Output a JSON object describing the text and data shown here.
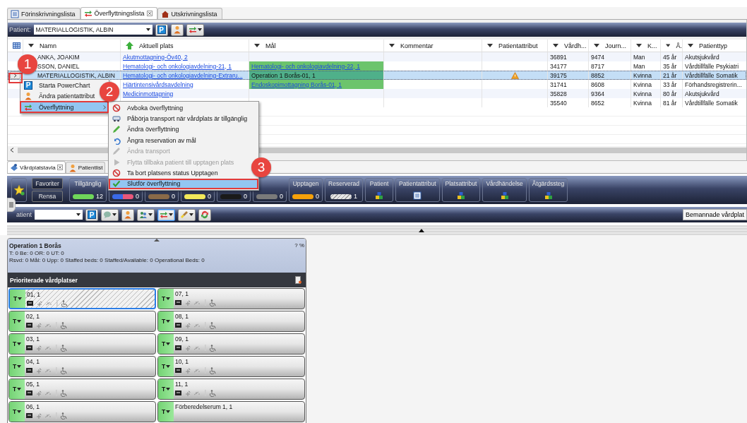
{
  "doc_tabs": [
    {
      "label": "Förinskrivningslista",
      "kind": "list",
      "selected": false,
      "closable": false
    },
    {
      "label": "Överflyttningslista",
      "kind": "transfer",
      "selected": true,
      "closable": true
    },
    {
      "label": "Utskrivningslista",
      "kind": "house",
      "selected": false,
      "closable": false
    }
  ],
  "patient_bar": {
    "label": "Patient:",
    "value": "MATERIALLOGISTIK, ALBIN",
    "buttons": [
      {
        "kind": "letter",
        "letter": "P",
        "dropdown": false,
        "selected": false
      },
      {
        "kind": "person",
        "dropdown": false,
        "selected": false
      },
      {
        "kind": "transfer",
        "dropdown": true,
        "selected": false
      }
    ]
  },
  "table": {
    "columns": [
      {
        "label": "Namn",
        "sorted": false
      },
      {
        "label": "Aktuell plats",
        "sorted": true
      },
      {
        "label": "Mål",
        "sorted": false
      },
      {
        "label": "Kommentar",
        "sorted": false
      },
      {
        "label": "Patientattribut",
        "sorted": false
      },
      {
        "label": "Vårdh...",
        "sorted": false
      },
      {
        "label": "Journ...",
        "sorted": false
      },
      {
        "label": "K...",
        "sorted": false
      },
      {
        "label": "Å.",
        "sorted": false
      },
      {
        "label": "Patienttyp",
        "sorted": false
      }
    ],
    "rows": [
      {
        "name": "ANKA, JOAKIM",
        "current": "Akutmottagning-Öv40, 2",
        "warning": false,
        "visit": "36891",
        "record": "9474",
        "sex": "Man",
        "age": "45 år",
        "type": "Akutsjukvård",
        "selected": false,
        "expanded": false
      },
      {
        "name": "SSON, DANIEL",
        "current": "Hematologi- och onkologiavdelning-21, 1",
        "target": {
          "text": "Hematologi- och onkologiavdelning-22, 1",
          "color": "#6cc46c",
          "linked": true
        },
        "warning": false,
        "visit": "34177",
        "record": "8717",
        "sex": "Man",
        "age": "35 år",
        "type": "Vårdtillfälle Psykiatri",
        "selected": false,
        "expanded": false
      },
      {
        "name": "MATERIALLOGISTIK, ALBIN",
        "current": "Hematologi- och onkologiavdelning-Extraru...",
        "target": {
          "text": "Operation 1 Borås-01, 1",
          "color": "#4fb08a",
          "linked": false
        },
        "warning": true,
        "visit": "39175",
        "record": "8852",
        "sex": "Kvinna",
        "age": "21 år",
        "type": "Vårdtillfälle Somatik",
        "selected": true,
        "expanded": true
      },
      {
        "current": "Hjärtintensivårdsavdelning",
        "target": {
          "text": "Endoskopimottagning Borås-01, 1",
          "color": "#6cc46c",
          "linked": true
        },
        "warning": false,
        "visit": "31741",
        "record": "8608",
        "sex": "Kvinna",
        "age": "33 år",
        "type": "Förhandsregistrerin...",
        "selected": false,
        "expanded": false
      },
      {
        "current": "Medicinmottagning",
        "warning": false,
        "visit": "35828",
        "record": "9364",
        "sex": "Kvinna",
        "age": "80 år",
        "type": "Akutsjukvård",
        "selected": false,
        "expanded": false
      },
      {
        "warning": false,
        "visit": "35540",
        "record": "8652",
        "sex": "Kvinna",
        "age": "81 år",
        "type": "Vårdtillfälle Somatik",
        "selected": false,
        "expanded": false
      }
    ]
  },
  "menu": {
    "items": [
      {
        "label": "Starta PowerChart",
        "kind": "letter",
        "letter": "P",
        "selected": false,
        "submenu": false
      },
      {
        "label": "Ändra patientattribut",
        "kind": "person",
        "selected": false,
        "submenu": false
      },
      {
        "label": "Överflyttning",
        "kind": "transfer",
        "selected": true,
        "submenu": true
      }
    ],
    "submenu": [
      {
        "label": "Avboka överflyttning",
        "kind": "cancel",
        "disabled": false,
        "selected": false
      },
      {
        "label": "Påbörja transport när vårdplats är tillgänglig",
        "kind": "vehicle",
        "disabled": false,
        "selected": false
      },
      {
        "label": "Ändra överflyttning",
        "kind": "pencil",
        "disabled": false,
        "selected": false
      },
      {
        "label": "Ångra reservation av mål",
        "kind": "undo",
        "disabled": false,
        "selected": false
      },
      {
        "label": "Ändra transport",
        "kind": "pencil",
        "disabled": true,
        "selected": false
      },
      {
        "label": "Flytta tillbaka patient till upptagen plats",
        "kind": "play",
        "disabled": true,
        "selected": false
      },
      {
        "label": "Ta bort platsens status Upptagen",
        "kind": "cancel",
        "disabled": false,
        "selected": false
      },
      {
        "label": "Slutför överflyttning",
        "kind": "check",
        "disabled": false,
        "selected": true
      }
    ]
  },
  "annotations": [
    {
      "label": "1"
    },
    {
      "label": "2"
    },
    {
      "label": "3"
    }
  ],
  "board_tabs": [
    {
      "label": "Vårdplatstavla",
      "kind": "board",
      "selected": true,
      "closable": true
    },
    {
      "label": "Patientlist",
      "kind": "person",
      "selected": false,
      "closable": false
    }
  ],
  "filters": {
    "favorites": "Favoriter",
    "clear": "Rensa",
    "items": [
      {
        "kind": "pill",
        "label": "Tillgänglig",
        "color": "#6fd65a",
        "count": "12"
      },
      {
        "kind": "dual-pill",
        "color": "#e8577a",
        "count": "0"
      },
      {
        "kind": "pill",
        "color": "#8a6a48",
        "count": "0"
      },
      {
        "kind": "pill",
        "color": "#f2e85a",
        "count": "0"
      },
      {
        "kind": "pill",
        "color": "#1a1a1a",
        "count": "0"
      },
      {
        "kind": "pill",
        "color": "#7a7a7a",
        "count": "0"
      },
      {
        "kind": "pill",
        "label": "Upptagen",
        "color": "#f5a00a",
        "count": "0"
      },
      {
        "kind": "striped-pill",
        "label": "Reserverad",
        "color": "#e6e6e6",
        "count": "1"
      },
      {
        "kind": "cubes",
        "label": "Patient"
      },
      {
        "kind": "list",
        "label": "Patientattribut"
      },
      {
        "kind": "cubes",
        "label": "Platsattribut"
      },
      {
        "kind": "cubes",
        "label": "Vårdhändelse"
      },
      {
        "kind": "cubes",
        "label": "Åtgärdssteg"
      }
    ]
  },
  "board_toolbar": {
    "label": "atient",
    "buttons": [
      {
        "kind": "letter",
        "letter": "P",
        "dropdown": false,
        "selected": false
      },
      {
        "kind": "chat",
        "dropdown": true,
        "selected": false
      },
      {
        "kind": "person",
        "dropdown": false,
        "selected": false
      },
      {
        "kind": "people",
        "dropdown": true,
        "selected": false
      },
      {
        "kind": "transfer",
        "dropdown": true,
        "selected": true
      },
      {
        "kind": "brush",
        "dropdown": true,
        "selected": false
      },
      {
        "kind": "refresh",
        "dropdown": false,
        "selected": false
      }
    ],
    "staffed_button": "Bemannade vårdplat"
  },
  "unit": {
    "name": "Operation 1 Borås",
    "percent": "? %",
    "stats": "T: 0 Be: 0 OR: 0 UT: 0",
    "details": "Rsvd: 0 Mål: 0 Upp: 0 Staffed beds: 0 Staffed/Available: 0 Operational Beds: 0",
    "section": "Prioriterade vårdplatser",
    "beds": [
      {
        "label": "01, 1",
        "tag": "T",
        "kind": "bed",
        "selected": true
      },
      {
        "label": "02, 1",
        "tag": "T",
        "kind": "bed",
        "selected": false
      },
      {
        "label": "03, 1",
        "tag": "T",
        "kind": "bed",
        "selected": false
      },
      {
        "label": "04, 1",
        "tag": "T",
        "kind": "bed",
        "selected": false
      },
      {
        "label": "05, 1",
        "tag": "T",
        "kind": "bed",
        "selected": false
      },
      {
        "label": "06, 1",
        "tag": "T",
        "kind": "bed",
        "selected": false
      },
      {
        "label": "07, 1",
        "tag": "T",
        "kind": "bed",
        "selected": false
      },
      {
        "label": "08, 1",
        "tag": "T",
        "kind": "bed",
        "selected": false
      },
      {
        "label": "09, 1",
        "tag": "T",
        "kind": "bed",
        "selected": false
      },
      {
        "label": "10, 1",
        "tag": "T",
        "kind": "bed",
        "selected": false
      },
      {
        "label": "11, 1",
        "tag": "T",
        "kind": "bed",
        "selected": false
      },
      {
        "label": "Förberedelserum 1, 1",
        "tag": "T",
        "kind": "room",
        "selected": false
      }
    ]
  }
}
